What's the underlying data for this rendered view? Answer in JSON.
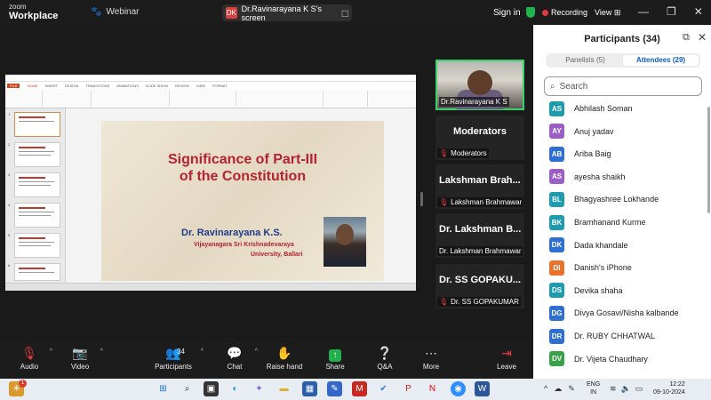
{
  "topbar": {
    "logo_line1": "zoom",
    "logo_line2": "Workplace",
    "webinar_label": "Webinar",
    "share_badge": "DK",
    "share_title": "Dr.Ravinarayana K S's screen",
    "signin": "Sign in",
    "recording": "Recording",
    "view": "View"
  },
  "slide": {
    "title_line1": "Significance of Part-III",
    "title_line2": "of the Constitution",
    "presenter": "Dr. Ravinarayana K.S.",
    "affiliation1": "Vijayanagara Sri Krishnadevaraya",
    "affiliation2": "University, Ballari"
  },
  "ppt": {
    "tabs": [
      "FILE",
      "HOME",
      "INSERT",
      "DESIGN",
      "TRANSITIONS",
      "ANIMATIONS",
      "SLIDE SHOW",
      "REVIEW",
      "VIEW",
      "FORMAT"
    ],
    "thumb_numbers": [
      "1",
      "2",
      "3",
      "4",
      "5",
      "6"
    ]
  },
  "videos": {
    "main_caption": "Dr.Ravinarayana K S",
    "tiles": [
      {
        "big": "Moderators",
        "small": "Moderators"
      },
      {
        "big": "Lakshman Brah...",
        "small": "Lakshman Brahmawar"
      },
      {
        "big": "Dr. Lakshman B...",
        "small": "Dr. Lakshman Brahmawar"
      },
      {
        "big": "Dr. SS GOPAKU...",
        "small": "Dr. SS GOPAKUMAR"
      }
    ]
  },
  "panel": {
    "title": "Participants (34)",
    "tab_panelists": "Panelists (5)",
    "tab_attendees": "Attendees (29)",
    "search_placeholder": "Search",
    "participants": [
      {
        "initials": "AS",
        "name": "Abhilash Soman",
        "color": "#1f9bb0"
      },
      {
        "initials": "AY",
        "name": "Anuj yadav",
        "color": "#9b5ec6"
      },
      {
        "initials": "AB",
        "name": "Ariba Baig",
        "color": "#2f6fd1"
      },
      {
        "initials": "AS",
        "name": "ayesha shaikh",
        "color": "#9b5ec6"
      },
      {
        "initials": "BL",
        "name": "Bhagyashree Lokhande",
        "color": "#1f9bb0"
      },
      {
        "initials": "BK",
        "name": "Bramhanand Kurme",
        "color": "#1f9bb0"
      },
      {
        "initials": "DK",
        "name": "Dada khandale",
        "color": "#2f6fd1"
      },
      {
        "initials": "DI",
        "name": "Danish's iPhone",
        "color": "#e8732a"
      },
      {
        "initials": "DS",
        "name": "Devika shaha",
        "color": "#1f9bb0"
      },
      {
        "initials": "DG",
        "name": "Divya Gosavi/Nisha kalbande",
        "color": "#2f6fd1"
      },
      {
        "initials": "DR",
        "name": "Dr. RUBY CHHATWAL",
        "color": "#2f6fd1"
      },
      {
        "initials": "DV",
        "name": "Dr. Vijeta Chaudhary",
        "color": "#3aa04a"
      }
    ]
  },
  "toolbar": {
    "audio": "Audio",
    "video": "Video",
    "participants": "Participants",
    "participants_count": "34",
    "chat": "Chat",
    "raise_hand": "Raise hand",
    "share": "Share",
    "qa": "Q&A",
    "more": "More",
    "leave": "Leave"
  },
  "taskbar": {
    "notif_count": "1",
    "lang1": "ENG",
    "lang2": "IN",
    "time": "12:22",
    "date": "09-10-2024"
  }
}
